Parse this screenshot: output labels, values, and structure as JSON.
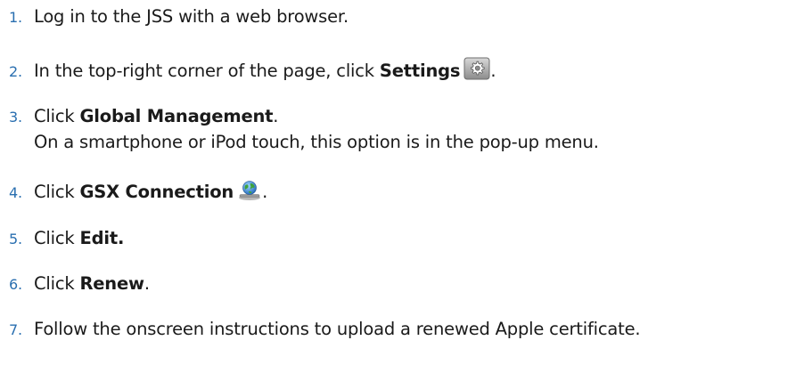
{
  "accent_color": "#2a6fb0",
  "steps": [
    {
      "num": "1.",
      "pre": "Log in to the JSS with a web browser.",
      "bold": "",
      "post": ""
    },
    {
      "num": "2.",
      "pre": "In the top-right corner of the page, click ",
      "bold": "Settings",
      "icon": "settings-gear-icon",
      "post": "."
    },
    {
      "num": "3.",
      "pre": "Click ",
      "bold": "Global Management",
      "post": ".",
      "subtext": "On a smartphone or iPod touch, this option is in the pop-up menu."
    },
    {
      "num": "4.",
      "pre": "Click ",
      "bold": "GSX Connection",
      "icon": "gsx-connection-icon",
      "post": "."
    },
    {
      "num": "5.",
      "pre": "Click ",
      "bold": "Edit.",
      "post": ""
    },
    {
      "num": "6.",
      "pre": "Click ",
      "bold": "Renew",
      "post": "."
    },
    {
      "num": "7.",
      "pre": "Follow the onscreen instructions to upload a renewed Apple certificate.",
      "bold": "",
      "post": ""
    }
  ]
}
